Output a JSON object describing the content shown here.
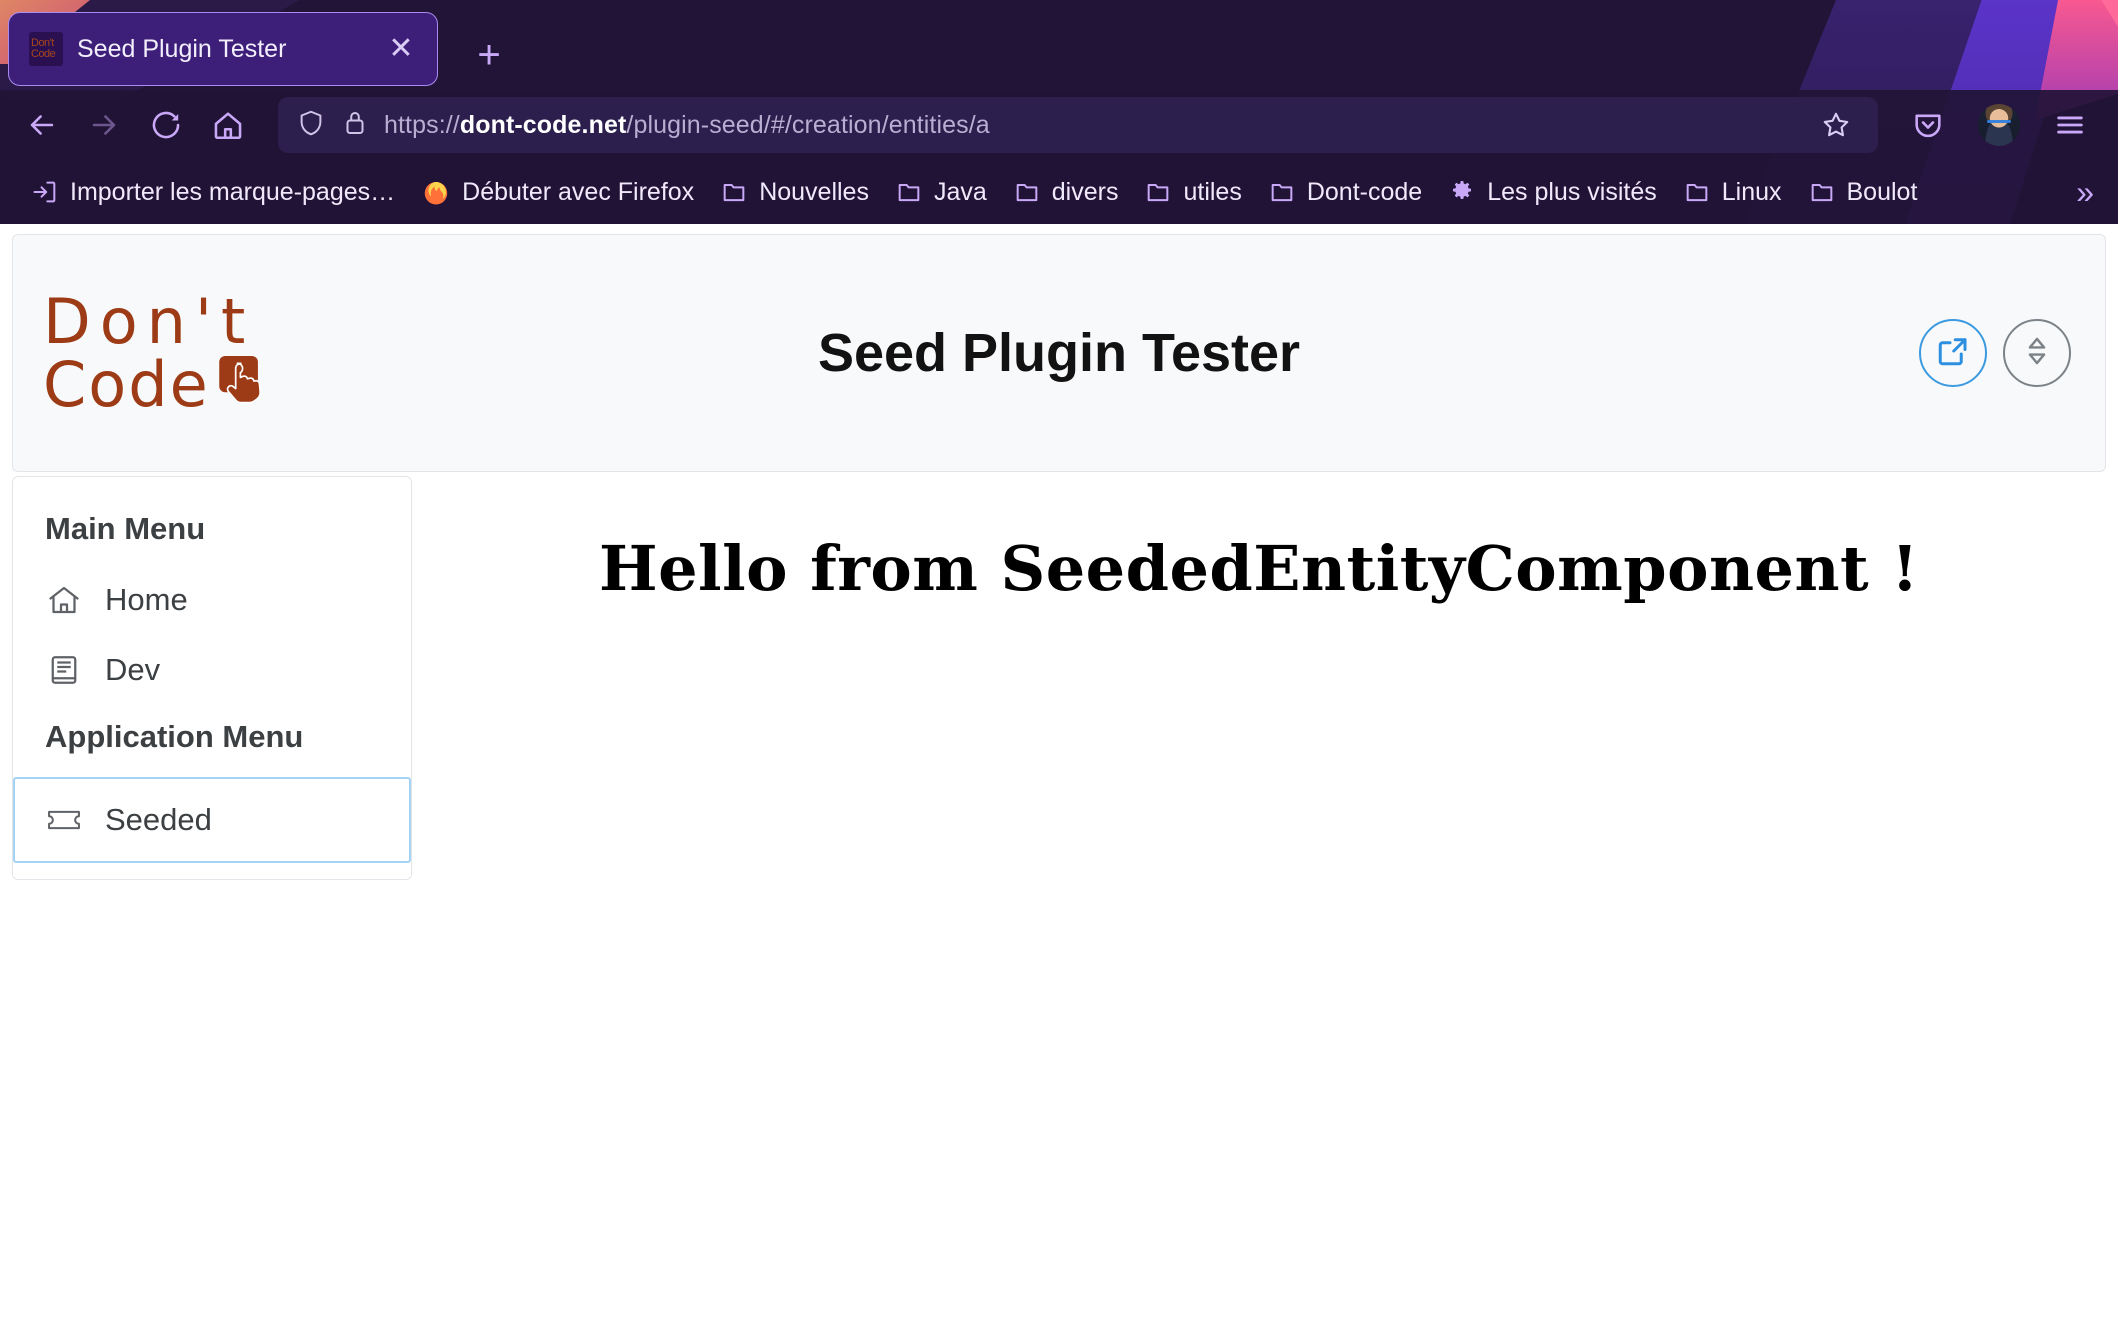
{
  "browser": {
    "tab": {
      "title": "Seed Plugin Tester",
      "favicon_line1": "Don't",
      "favicon_line2": "Code",
      "close_label": "✕"
    },
    "new_tab_label": "+",
    "nav": {
      "back": "back-arrow",
      "forward": "forward-arrow",
      "reload": "reload",
      "home": "home"
    },
    "url": {
      "scheme": "https://",
      "host": "dont-code.net",
      "path": "/plugin-seed/#/creation/entities/a",
      "full": "https://dont-code.net/plugin-seed/#/creation/entities/a"
    },
    "toolbar_icons": [
      "shield-icon",
      "lock-icon",
      "bookmark-star-icon",
      "pocket-icon",
      "profile-avatar",
      "hamburger-menu-icon"
    ],
    "bookmarks": [
      {
        "label": "Importer les marque-pages…",
        "icon": "import-icon"
      },
      {
        "label": "Débuter avec Firefox",
        "icon": "firefox-icon"
      },
      {
        "label": "Nouvelles",
        "icon": "folder-icon"
      },
      {
        "label": "Java",
        "icon": "folder-icon"
      },
      {
        "label": "divers",
        "icon": "folder-icon"
      },
      {
        "label": "utiles",
        "icon": "folder-icon"
      },
      {
        "label": "Dont-code",
        "icon": "folder-icon"
      },
      {
        "label": "Les plus visités",
        "icon": "gear-icon"
      },
      {
        "label": "Linux",
        "icon": "folder-icon"
      },
      {
        "label": "Boulot",
        "icon": "folder-icon"
      }
    ],
    "bookmarks_overflow_label": "»"
  },
  "page": {
    "logo": {
      "line1": "Don't",
      "line2": "Code",
      "color": "#9c3b15"
    },
    "title": "Seed Plugin Tester",
    "header_actions": [
      {
        "name": "open-external-button",
        "icon": "external-link-icon",
        "color": "#3b9ae1"
      },
      {
        "name": "expand-collapse-button",
        "icon": "sort-up-down-icon",
        "color": "#7b8288"
      }
    ],
    "sidebar": {
      "groups": [
        {
          "header": "Main Menu",
          "items": [
            {
              "label": "Home",
              "icon": "home-icon",
              "selected": false
            },
            {
              "label": "Dev",
              "icon": "article-icon",
              "selected": false
            }
          ]
        },
        {
          "header": "Application Menu",
          "items": [
            {
              "label": "Seeded",
              "icon": "ticket-icon",
              "selected": true
            }
          ]
        }
      ],
      "selected_border_color": "#a4d4f4"
    },
    "main": {
      "heading": "Hello from SeededEntityComponent !"
    }
  }
}
